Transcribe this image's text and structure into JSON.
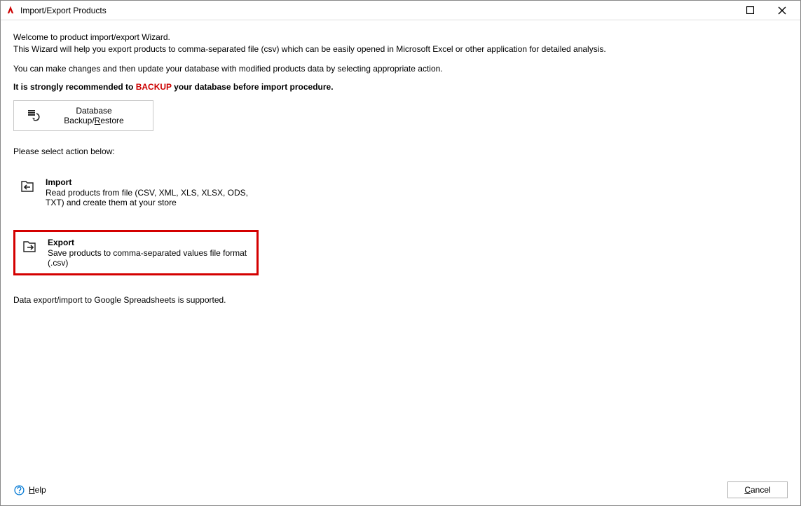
{
  "titlebar": {
    "title": "Import/Export Products"
  },
  "intro": {
    "line1": "Welcome to product import/export Wizard.",
    "line2": "This Wizard will help you export products to comma-separated file (csv) which can be easily opened in Microsoft Excel or other application for detailed analysis.",
    "line3": "You can make changes and then update your database with modified products data by selecting appropriate action."
  },
  "recommend": {
    "prefix": "It is strongly recommended to ",
    "backup": "BACKUP",
    "suffix": " your database before import procedure."
  },
  "backup_button": {
    "label": "Database Backup/Restore",
    "underline_char": "R",
    "label_before": "Database Backup/",
    "label_underline": "R",
    "label_after": "estore"
  },
  "select_label": "Please select action below:",
  "options": {
    "import": {
      "title": "Import",
      "desc": "Read products from file (CSV, XML, XLS, XLSX, ODS, TXT) and create them at your store"
    },
    "export": {
      "title": "Export",
      "desc": "Save products to comma-separated values file format (.csv)"
    }
  },
  "google_note": "Data export/import to Google Spreadsheets is supported.",
  "footer": {
    "help_before": "",
    "help_underline": "H",
    "help_after": "elp",
    "cancel_before": "",
    "cancel_underline": "C",
    "cancel_after": "ancel"
  }
}
